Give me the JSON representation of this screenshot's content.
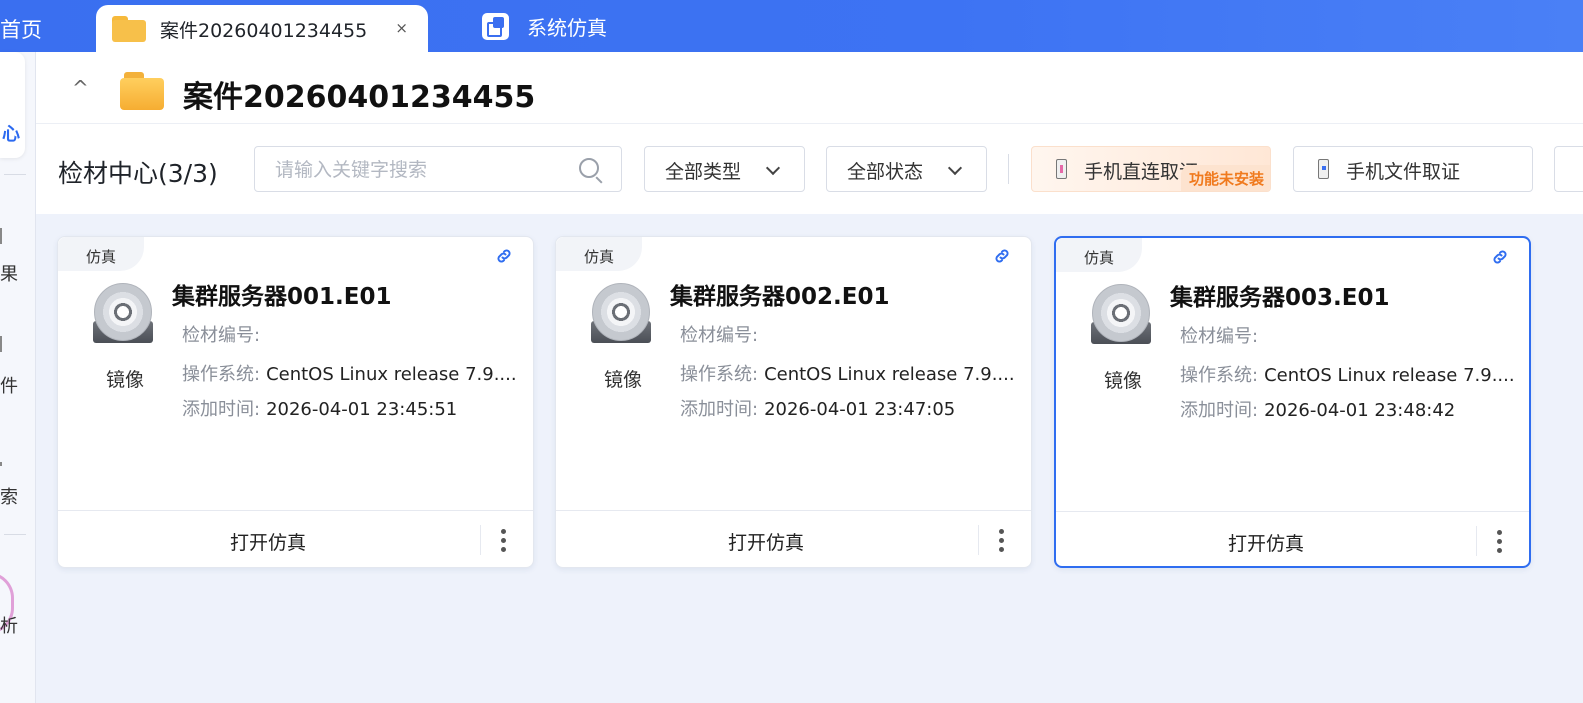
{
  "tabs": {
    "home_label": "首页",
    "active_label": "案件20260401234455",
    "close_glyph": "×",
    "sim_label": "系统仿真"
  },
  "sidenav": {
    "active_label": "心",
    "labels": [
      "果",
      "件",
      "索",
      "析"
    ]
  },
  "header": {
    "collapse_glyph": "^",
    "title": "案件20260401234455"
  },
  "toolbar": {
    "section_title": "检材中心(3/3)",
    "search_placeholder": "请输入关键字搜索",
    "type_filter": "全部类型",
    "status_filter": "全部状态",
    "phone_direct_label": "手机直连取证",
    "phone_direct_badge": "功能未安装",
    "phone_file_label": "手机文件取证"
  },
  "cards": [
    {
      "tag": "仿真",
      "name": "集群服务器001.E01",
      "kind": "镜像",
      "id_label": "检材编号:",
      "id_value": "",
      "os_label": "操作系统:",
      "os_value": "CentOS Linux release 7.9....",
      "time_label": "添加时间:",
      "time_value": "2026-04-01 23:45:51",
      "action": "打开仿真"
    },
    {
      "tag": "仿真",
      "name": "集群服务器002.E01",
      "kind": "镜像",
      "id_label": "检材编号:",
      "id_value": "",
      "os_label": "操作系统:",
      "os_value": "CentOS Linux release 7.9....",
      "time_label": "添加时间:",
      "time_value": "2026-04-01 23:47:05",
      "action": "打开仿真"
    },
    {
      "tag": "仿真",
      "name": "集群服务器003.E01",
      "kind": "镜像",
      "id_label": "检材编号:",
      "id_value": "",
      "os_label": "操作系统:",
      "os_value": "CentOS Linux release 7.9....",
      "time_label": "添加时间:",
      "time_value": "2026-04-01 23:48:42",
      "action": "打开仿真"
    }
  ],
  "colors": {
    "accent": "#2f6df0",
    "tabbar": "#3a6ff0",
    "badge_text": "#f07a1e"
  }
}
